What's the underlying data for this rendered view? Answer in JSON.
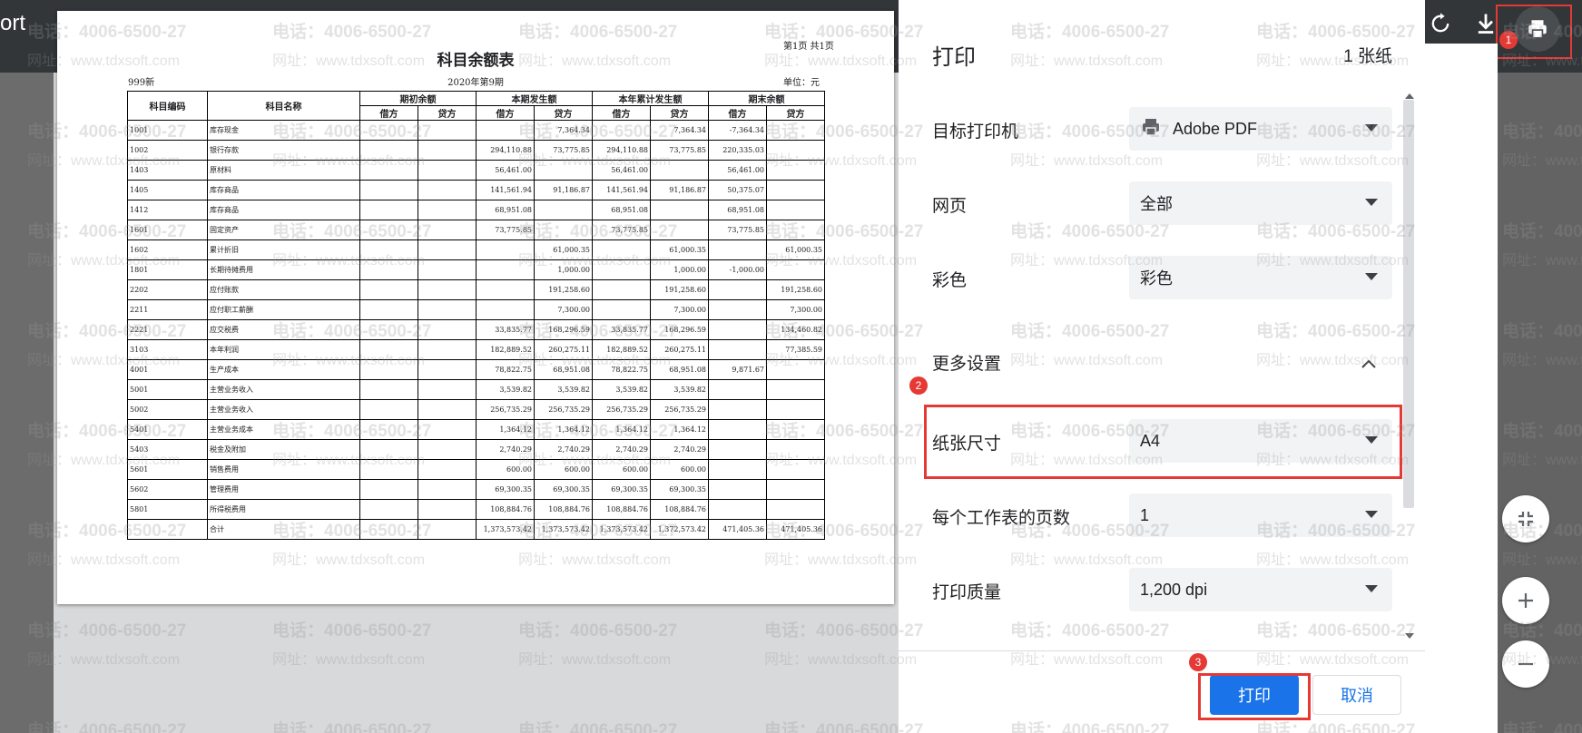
{
  "app": {
    "title": "ort"
  },
  "toolbar": {
    "rotate_icon": "rotate-icon",
    "download_icon": "download-icon",
    "print_icon": "print-icon"
  },
  "document": {
    "title": "科目余额表",
    "page_info": "第1页 共1页",
    "company": "999新",
    "period": "2020年第9期",
    "unit": "单位：元",
    "headers": {
      "code": "科目编码",
      "name": "科目名称",
      "groups": [
        "期初余额",
        "本期发生额",
        "本年累计发生额",
        "期末余额"
      ],
      "debit": "借方",
      "credit": "贷方"
    },
    "rows": [
      {
        "code": "1001",
        "name": "库存现金",
        "vals": [
          "",
          "",
          "",
          "7,364.34",
          "",
          "7,364.34",
          "-7,364.34",
          ""
        ]
      },
      {
        "code": "1002",
        "name": "银行存款",
        "vals": [
          "",
          "",
          "294,110.88",
          "73,775.85",
          "294,110.88",
          "73,775.85",
          "220,335.03",
          ""
        ]
      },
      {
        "code": "1403",
        "name": "原材料",
        "vals": [
          "",
          "",
          "56,461.00",
          "",
          "56,461.00",
          "",
          "56,461.00",
          ""
        ]
      },
      {
        "code": "1405",
        "name": "库存商品",
        "vals": [
          "",
          "",
          "141,561.94",
          "91,186.87",
          "141,561.94",
          "91,186.87",
          "50,375.07",
          ""
        ]
      },
      {
        "code": "1412",
        "name": "库存商品",
        "vals": [
          "",
          "",
          "68,951.08",
          "",
          "68,951.08",
          "",
          "68,951.08",
          ""
        ]
      },
      {
        "code": "1601",
        "name": "固定资产",
        "vals": [
          "",
          "",
          "73,775.85",
          "",
          "73,775.85",
          "",
          "73,775.85",
          ""
        ]
      },
      {
        "code": "1602",
        "name": "累计折旧",
        "vals": [
          "",
          "",
          "",
          "61,000.35",
          "",
          "61,000.35",
          "",
          "61,000.35"
        ]
      },
      {
        "code": "1801",
        "name": "长期待摊费用",
        "vals": [
          "",
          "",
          "",
          "1,000.00",
          "",
          "1,000.00",
          "-1,000.00",
          ""
        ]
      },
      {
        "code": "2202",
        "name": "应付账款",
        "vals": [
          "",
          "",
          "",
          "191,258.60",
          "",
          "191,258.60",
          "",
          "191,258.60"
        ]
      },
      {
        "code": "2211",
        "name": "应付职工薪酬",
        "vals": [
          "",
          "",
          "",
          "7,300.00",
          "",
          "7,300.00",
          "",
          "7,300.00"
        ]
      },
      {
        "code": "2221",
        "name": "应交税费",
        "vals": [
          "",
          "",
          "33,835.77",
          "168,296.59",
          "33,835.77",
          "168,296.59",
          "",
          "134,460.82"
        ]
      },
      {
        "code": "3103",
        "name": "本年利润",
        "vals": [
          "",
          "",
          "182,889.52",
          "260,275.11",
          "182,889.52",
          "260,275.11",
          "",
          "77,385.59"
        ]
      },
      {
        "code": "4001",
        "name": "生产成本",
        "vals": [
          "",
          "",
          "78,822.75",
          "68,951.08",
          "78,822.75",
          "68,951.08",
          "9,871.67",
          ""
        ]
      },
      {
        "code": "5001",
        "name": "主营业务收入",
        "vals": [
          "",
          "",
          "3,539.82",
          "3,539.82",
          "3,539.82",
          "3,539.82",
          "",
          ""
        ]
      },
      {
        "code": "5002",
        "name": "主营业务收入",
        "vals": [
          "",
          "",
          "256,735.29",
          "256,735.29",
          "256,735.29",
          "256,735.29",
          "",
          ""
        ]
      },
      {
        "code": "5401",
        "name": "主营业务成本",
        "vals": [
          "",
          "",
          "1,364.12",
          "1,364.12",
          "1,364.12",
          "1,364.12",
          "",
          ""
        ]
      },
      {
        "code": "5403",
        "name": "税金及附加",
        "vals": [
          "",
          "",
          "2,740.29",
          "2,740.29",
          "2,740.29",
          "2,740.29",
          "",
          ""
        ]
      },
      {
        "code": "5601",
        "name": "销售费用",
        "vals": [
          "",
          "",
          "600.00",
          "600.00",
          "600.00",
          "600.00",
          "",
          ""
        ]
      },
      {
        "code": "5602",
        "name": "管理费用",
        "vals": [
          "",
          "",
          "69,300.35",
          "69,300.35",
          "69,300.35",
          "69,300.35",
          "",
          ""
        ]
      },
      {
        "code": "5801",
        "name": "所得税费用",
        "vals": [
          "",
          "",
          "108,884.76",
          "108,884.76",
          "108,884.76",
          "108,884.76",
          "",
          ""
        ]
      },
      {
        "code": "",
        "name": "合计",
        "vals": [
          "",
          "",
          "1,373,573.42",
          "1,373,573.42",
          "1,373,573.42",
          "1,372,573.42",
          "471,405.36",
          "471,405.36"
        ]
      }
    ]
  },
  "dialog": {
    "title": "打印",
    "sheet_count": "1 张纸",
    "destination": {
      "label": "目标打印机",
      "value": "Adobe PDF",
      "icon": "printer-icon"
    },
    "pages": {
      "label": "网页",
      "value": "全部"
    },
    "color": {
      "label": "彩色",
      "value": "彩色"
    },
    "more_settings": {
      "label": "更多设置"
    },
    "paper_size": {
      "label": "纸张尺寸",
      "value": "A4"
    },
    "pages_per_sheet": {
      "label": "每个工作表的页数",
      "value": "1"
    },
    "quality": {
      "label": "打印质量",
      "value": "1,200 dpi"
    },
    "print_label": "打印",
    "cancel_label": "取消"
  },
  "markers": [
    "1",
    "2",
    "3"
  ],
  "watermark": {
    "phone": "电话：4006-6500-27",
    "site": "网址：www.tdxsoft.com"
  },
  "colors": {
    "accent": "#1a73e8",
    "highlight": "#e53935",
    "topbar": "#323639"
  }
}
